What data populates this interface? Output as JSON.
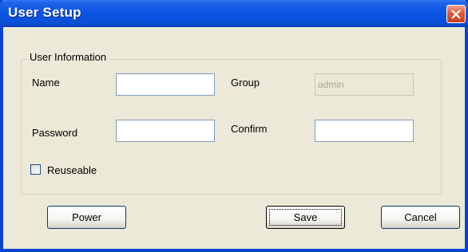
{
  "window": {
    "title": "User Setup"
  },
  "group": {
    "label": "User Information"
  },
  "fields": {
    "name_label": "Name",
    "name_value": "",
    "group_label": "Group",
    "group_value": "admin",
    "password_label": "Password",
    "password_value": "",
    "confirm_label": "Confirm",
    "confirm_value": ""
  },
  "reuseable": {
    "label": "Reuseable",
    "checked": false
  },
  "buttons": {
    "power": "Power",
    "save": "Save",
    "cancel": "Cancel"
  },
  "icons": {
    "close": "close-icon"
  },
  "colors": {
    "titlebar": "#0a54e4",
    "close": "#e25a36",
    "face": "#ece9d8"
  }
}
